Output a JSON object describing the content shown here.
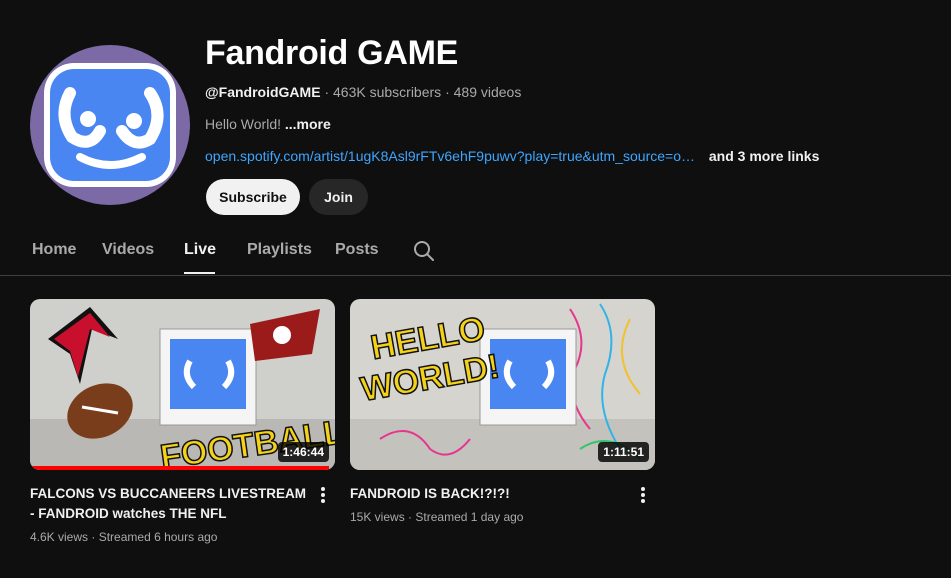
{
  "channel": {
    "name": "Fandroid GAME",
    "handle": "@FandroidGAME",
    "subscribers": "463K subscribers",
    "videos": "489 videos",
    "separator": "·",
    "description": "Hello World!",
    "more_label": "...more",
    "link": "open.spotify.com/artist/1ugK8Asl9rFTv6ehF9puwv?play=true&utm_source=o…",
    "more_links": "and 3 more links",
    "avatar_icon": "fandroid-robot-face-icon",
    "colors": {
      "avatar_ring": "#7b6aa6",
      "avatar_screen": "#4a86f2"
    }
  },
  "actions": {
    "subscribe": "Subscribe",
    "join": "Join"
  },
  "tabs": [
    {
      "label": "Home",
      "active": false
    },
    {
      "label": "Videos",
      "active": false
    },
    {
      "label": "Live",
      "active": true
    },
    {
      "label": "Playlists",
      "active": false
    },
    {
      "label": "Posts",
      "active": false
    }
  ],
  "search_icon": "search-icon",
  "videos": [
    {
      "title": "FALCONS VS BUCCANEERS LIVESTREAM - FANDROID watches THE NFL",
      "duration": "1:46:44",
      "views": "4.6K views",
      "streamed": "Streamed 6 hours ago",
      "thumb_text": "FOOTBALL??",
      "watch_progress": 0.98
    },
    {
      "title": "FANDROID IS BACK!?!?!",
      "duration": "1:11:51",
      "views": "15K views",
      "streamed": "Streamed 1 day ago",
      "thumb_text_1": "HELLO",
      "thumb_text_2": "WORLD!"
    }
  ],
  "colors": {
    "accent_link": "#3ea6ff",
    "progress": "#ff0000",
    "background": "#0f0f0f"
  }
}
